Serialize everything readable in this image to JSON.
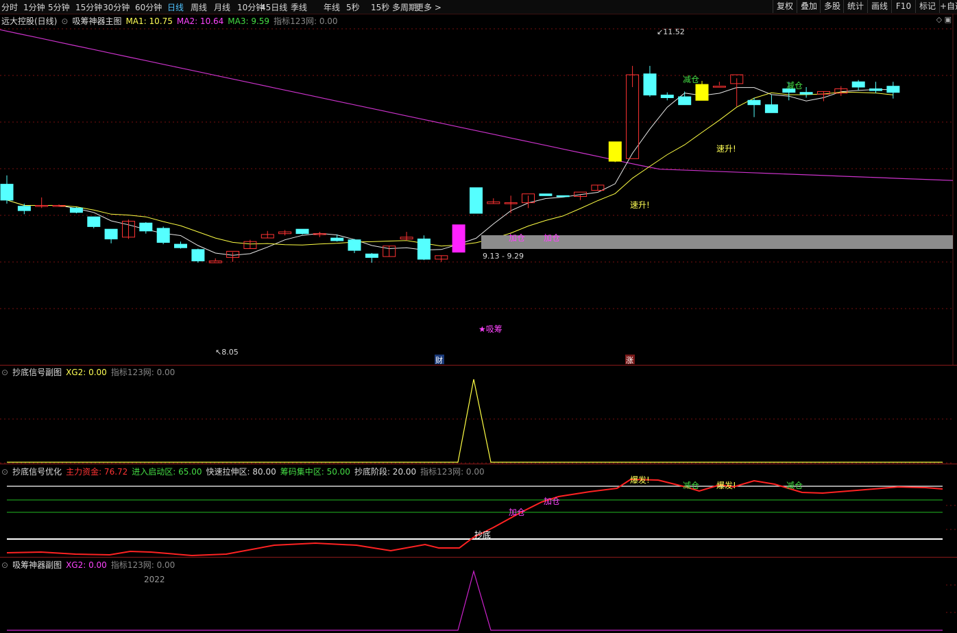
{
  "toolbar": {
    "tabs": [
      "分时",
      "1分钟",
      "5分钟",
      "15分钟",
      "30分钟",
      "60分钟",
      "日线",
      "周线",
      "月线",
      "10分钟",
      "45日线",
      "季线",
      "年线",
      "5秒",
      "15秒",
      "多周期",
      "更多 >"
    ],
    "active_tab": "日线",
    "right_buttons": [
      "复权",
      "叠加",
      "多股",
      "统计",
      "画线",
      "F10",
      "标记",
      "+自选"
    ]
  },
  "main_panel": {
    "stock_title": "远大控股(日线)",
    "indicator_name": "吸筹神器主图",
    "ma1": "MA1: 10.75",
    "ma2": "MA2: 10.64",
    "ma3": "MA3: 9.59",
    "source": "指标123网: 0.00",
    "high_label": "11.52",
    "low_label": "8.05",
    "zone_label": "9.13 - 9.29",
    "signals": [
      "★吸筹",
      "加仓",
      "加仓",
      "速升!",
      "速升!",
      "减仓",
      "减仓"
    ],
    "badges": [
      "财",
      "涨"
    ]
  },
  "sub1": {
    "name": "抄底信号副图",
    "xg": "XG2: 0.00",
    "source": "指标123网: 0.00"
  },
  "sub2": {
    "name": "抄底信号优化",
    "fund": "主力资金: 76.72",
    "start": "进入启动区: 65.00",
    "stretch": "快速拉伸区: 80.00",
    "chip": "筹码集中区: 50.00",
    "bottom": "抄底阶段: 20.00",
    "source": "指标123网: 0.00",
    "labels": [
      "抄底",
      "加仓",
      "加仓",
      "爆发!",
      "减仓",
      "爆发!",
      "减仓"
    ]
  },
  "sub3": {
    "name": "吸筹神器副图",
    "xg": "XG2: 0.00",
    "source": "指标123网: 0.00",
    "year": "2022"
  },
  "colors": {
    "up": "#ff3333",
    "down": "#55ffff",
    "ma1": "#e8e8e8",
    "ma2": "#ffff44",
    "ma3": "#cc33cc",
    "grid": "#7a1010"
  },
  "chart_data": {
    "type": "candlestick",
    "ohlc": [
      [
        9.8,
        9.9,
        9.58,
        9.62
      ],
      [
        9.55,
        9.58,
        9.46,
        9.5
      ],
      [
        9.56,
        9.65,
        9.53,
        9.56
      ],
      [
        9.56,
        9.57,
        9.55,
        9.56
      ],
      [
        9.53,
        9.54,
        9.47,
        9.48
      ],
      [
        9.43,
        9.43,
        9.3,
        9.32
      ],
      [
        9.29,
        9.29,
        9.13,
        9.18
      ],
      [
        9.2,
        9.4,
        9.18,
        9.38
      ],
      [
        9.36,
        9.37,
        9.24,
        9.27
      ],
      [
        9.3,
        9.32,
        9.12,
        9.14
      ],
      [
        9.12,
        9.15,
        9.07,
        9.08
      ],
      [
        9.06,
        9.07,
        8.91,
        8.93
      ],
      [
        8.91,
        8.96,
        8.93,
        8.93
      ],
      [
        8.97,
        9.03,
        8.92,
        9.04
      ],
      [
        9.07,
        9.17,
        9.07,
        9.15
      ],
      [
        9.19,
        9.27,
        9.19,
        9.23
      ],
      [
        9.24,
        9.28,
        9.22,
        9.26
      ],
      [
        9.29,
        9.29,
        9.23,
        9.24
      ],
      [
        9.24,
        9.26,
        9.2,
        9.24
      ],
      [
        9.19,
        9.23,
        9.15,
        9.16
      ],
      [
        9.17,
        9.18,
        9.02,
        9.05
      ],
      [
        9.01,
        9.02,
        8.91,
        8.97
      ],
      [
        8.98,
        9.1,
        8.98,
        9.1
      ],
      [
        9.18,
        9.26,
        9.16,
        9.2
      ],
      [
        9.18,
        9.22,
        8.94,
        8.95
      ],
      [
        8.95,
        8.99,
        8.92,
        8.99
      ],
      [
        9.03,
        9.34,
        9.03,
        9.34
      ],
      [
        9.76,
        9.76,
        9.47,
        9.47
      ],
      [
        9.58,
        9.64,
        9.58,
        9.6
      ],
      [
        9.58,
        9.67,
        9.47,
        9.59
      ],
      [
        9.59,
        9.67,
        9.53,
        9.69
      ],
      [
        9.69,
        9.69,
        9.67,
        9.67
      ],
      [
        9.67,
        9.67,
        9.65,
        9.66
      ],
      [
        9.66,
        9.68,
        9.62,
        9.71
      ],
      [
        9.73,
        9.79,
        9.73,
        9.79
      ],
      [
        10.28,
        10.28,
        10.05,
        10.06
      ],
      [
        10.09,
        11.14,
        10.9,
        11.04
      ],
      [
        11.05,
        11.14,
        10.79,
        10.81
      ],
      [
        10.81,
        10.84,
        10.75,
        10.78
      ],
      [
        10.79,
        10.85,
        10.76,
        10.7
      ],
      [
        10.75,
        10.97,
        10.82,
        10.93
      ],
      [
        10.91,
        10.96,
        10.92,
        10.91
      ],
      [
        10.94,
        11.0,
        10.68,
        11.04
      ],
      [
        10.75,
        10.78,
        10.56,
        10.7
      ],
      [
        10.7,
        10.81,
        10.68,
        10.61
      ],
      [
        10.88,
        10.96,
        10.75,
        10.84
      ],
      [
        10.84,
        10.9,
        10.78,
        10.82
      ],
      [
        10.82,
        10.85,
        10.74,
        10.85
      ],
      [
        10.83,
        10.91,
        10.8,
        10.88
      ],
      [
        10.96,
        10.98,
        10.86,
        10.9
      ],
      [
        10.88,
        10.96,
        10.83,
        10.86
      ],
      [
        10.91,
        10.96,
        10.77,
        10.84
      ]
    ],
    "ylim": [
      7.8,
      11.7
    ]
  }
}
